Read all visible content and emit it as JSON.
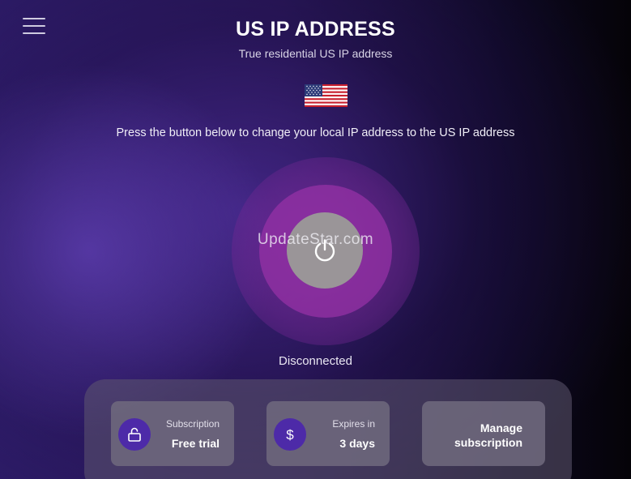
{
  "header": {
    "title": "US IP ADDRESS",
    "subtitle": "True residential US IP address"
  },
  "icons": {
    "menu": "hamburger-menu-icon",
    "flag": "us-flag-icon",
    "power": "power-icon",
    "subscription": "unlock-icon",
    "expires": "dollar-icon"
  },
  "instruction": "Press the button below to change your local IP address to the US IP address",
  "watermark": "UpdateStar.com",
  "connection": {
    "status": "Disconnected"
  },
  "cards": {
    "subscription": {
      "label": "Subscription",
      "value": "Free trial"
    },
    "expires": {
      "label": "Expires in",
      "value": "3 days"
    },
    "manage": {
      "line1": "Manage",
      "line2": "subscription"
    }
  },
  "colors": {
    "accent": "#4d2aa8",
    "ring": "#9632aa",
    "power_button": "#9a9598",
    "background_left": "#2c1b66",
    "background_right": "#050308"
  }
}
